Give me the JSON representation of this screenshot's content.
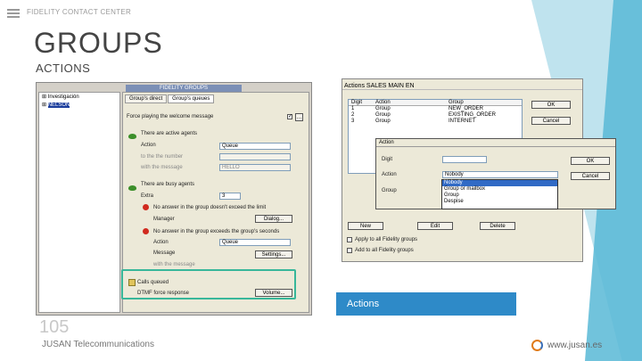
{
  "header": {
    "brand": "FIDELITY CONTACT CENTER"
  },
  "slide": {
    "title": "GROUPS",
    "subtitle": "ACTIONS",
    "page_number": "105"
  },
  "footer": {
    "company_bold": "JUSAN",
    "company_rest": " Telecommunications",
    "url": "www.jusan.es"
  },
  "caption": "Actions",
  "colors": {
    "accent_blue": "#2e8ac8",
    "highlight_green": "#38b79a",
    "deco_light": "#bfe3ee",
    "deco_dark": "#58b8d6"
  },
  "left_window": {
    "title": "FIDELITY GROUPS",
    "tree": [
      {
        "label": "Investigación"
      },
      {
        "label": "NELSON"
      }
    ],
    "tabs": [
      "Group's direct",
      "Group's queues"
    ],
    "welcome_label": "Force playing the welcome message",
    "free_agent_label": "There are active agents",
    "action_label": "Action",
    "action_value": "Queue",
    "to_label": "to the the number",
    "message_label": "with the message",
    "message_value": "HELLO",
    "busy_label": "There are busy agents",
    "extra_label": "Extra",
    "extra_value": "3",
    "no_answer_label": "No answer in the group doesn't exceed the limit",
    "manager_label": "Manager",
    "ok_button_1": "Dialog...",
    "exceed_label": "No answer in the group exceeds the group's seconds",
    "action2_label": "Action",
    "action2_value": "Queue",
    "message2_label": "Message",
    "settings_button": "Settings...",
    "message3_label": "with the message",
    "calls_label": "Calls queued",
    "dtmf_label": "DTMF force response",
    "volume_button": "Volume..."
  },
  "right_window": {
    "menu": "Actions   SALES MAIN EN",
    "columns": [
      "Digit",
      "Action",
      "Group"
    ],
    "rows": [
      {
        "digit": "1",
        "action": "Group",
        "group": "NEW_ORDER"
      },
      {
        "digit": "2",
        "action": "Group",
        "group": "EXISTING_ORDER"
      },
      {
        "digit": "3",
        "action": "Group",
        "group": "INTERNET"
      }
    ],
    "ok_button": "OK",
    "cancel_button": "Cancel",
    "dialog": {
      "title": "Action",
      "digit_label": "Digit",
      "action_label": "Action",
      "group_label": "Group",
      "action_value": "Nobody",
      "ok_button": "OK",
      "cancel_button": "Cancel",
      "options": [
        "Nobody",
        "Group or mailbox",
        "Group",
        "Despise"
      ]
    },
    "new_button": "New",
    "edit_button": "Edit",
    "delete_button": "Delete",
    "apply_label": "Apply to all Fidelity groups",
    "add_label": "Add to all Fidelity groups"
  }
}
